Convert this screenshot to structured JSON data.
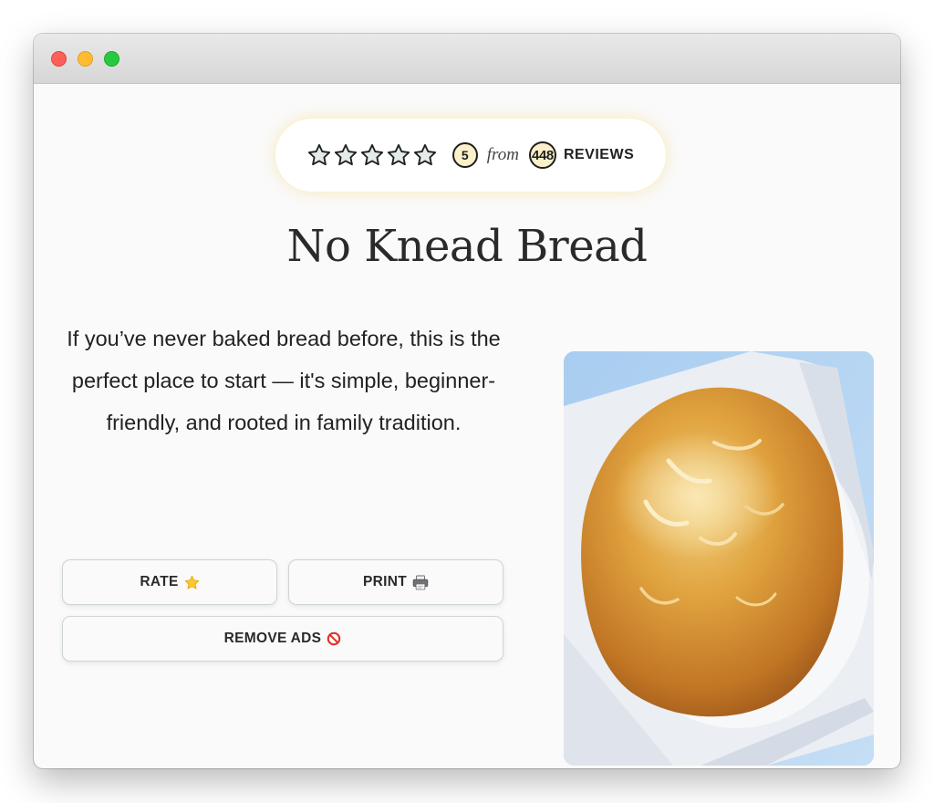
{
  "rating": {
    "stars_filled": 0,
    "stars_total": 5,
    "score": "5",
    "from_label": "from",
    "review_count": "448",
    "reviews_label": "REVIEWS"
  },
  "recipe": {
    "title": "No Knead Bread",
    "description": "If you’ve never baked bread before, this is the perfect place to start — it's simple, beginner-friendly, and rooted in family tradition."
  },
  "buttons": {
    "rate": {
      "label": "RATE",
      "icon": "star-emoji-icon"
    },
    "print": {
      "label": "PRINT",
      "icon": "printer-emoji-icon"
    },
    "remove_ads": {
      "label": "REMOVE ADS",
      "icon": "prohibited-emoji-icon"
    }
  },
  "colors": {
    "score_circle": "#fbf0c9",
    "star_fill": "#e4ecea",
    "button_border": "#cdd5d3"
  }
}
